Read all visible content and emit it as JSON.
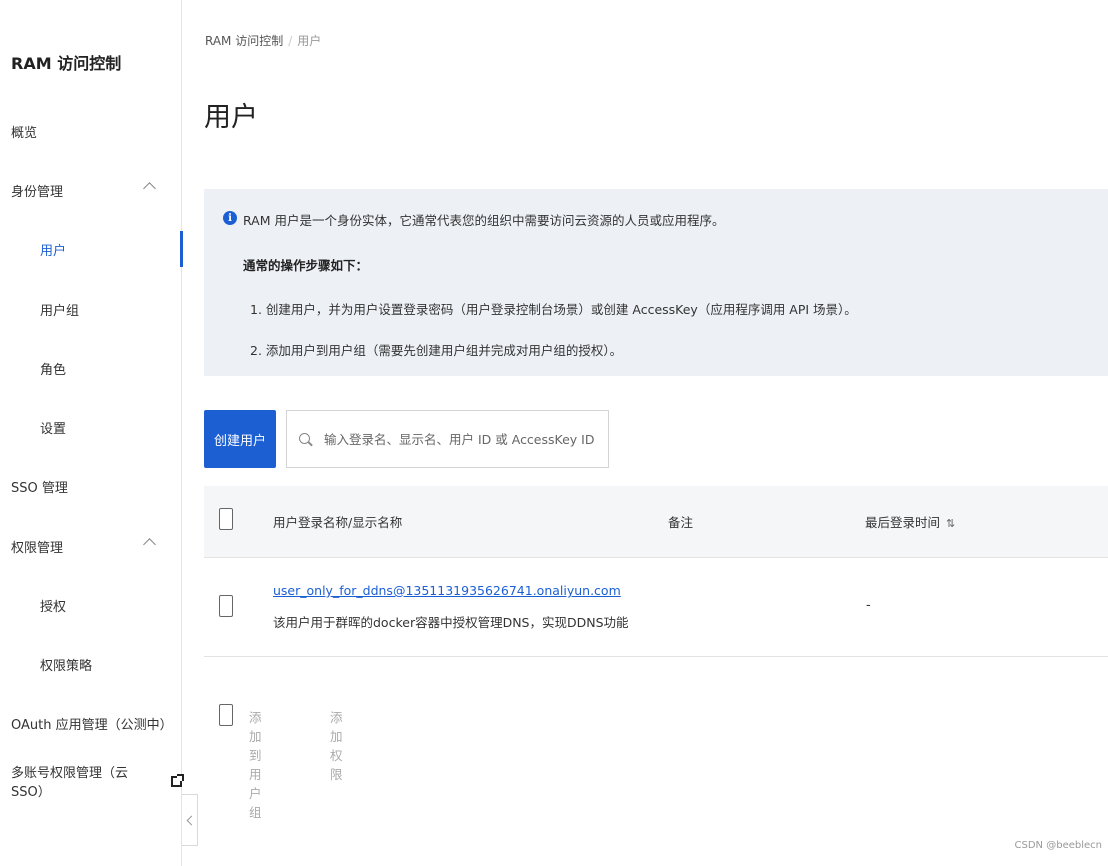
{
  "sidebar": {
    "title": "RAM 访问控制",
    "items": [
      {
        "label": "概览"
      },
      {
        "label": "身份管理"
      },
      {
        "label": "用户"
      },
      {
        "label": "用户组"
      },
      {
        "label": "角色"
      },
      {
        "label": "设置"
      },
      {
        "label": "SSO 管理"
      },
      {
        "label": "权限管理"
      },
      {
        "label": "授权"
      },
      {
        "label": "权限策略"
      },
      {
        "label": "OAuth 应用管理（公测中）"
      },
      {
        "label": "多账号权限管理（云 SSO）"
      }
    ],
    "active_item": "用户",
    "icons": {
      "expand": "chevron-up-icon",
      "external": "external-link-icon",
      "collapse": "chevron-left-icon"
    }
  },
  "breadcrumb": {
    "root": "RAM 访问控制",
    "separator": "/",
    "current": "用户"
  },
  "page_title": "用户",
  "info": {
    "line1": "RAM 用户是一个身份实体，它通常代表您的组织中需要访问云资源的人员或应用程序。",
    "heading": "通常的操作步骤如下：",
    "step1": "1. 创建用户，并为用户设置登录密码（用户登录控制台场景）或创建 AccessKey（应用程序调用 API 场景）。",
    "step2": "2. 添加用户到用户组（需要先创建用户组并完成对用户组的授权）。"
  },
  "toolbar": {
    "create_label": "创建用户",
    "search_placeholder": "输入登录名、显示名、用户 ID 或 AccessKey ID"
  },
  "table": {
    "columns": [
      "用户登录名称/显示名称",
      "备注",
      "最后登录时间"
    ],
    "sort_icon": "⇅",
    "rows": [
      {
        "login_name": "user_only_for_ddns@1351131935626741.onaliyun.com",
        "display_name": "该用户用于群晖的docker容器中授权管理DNS，实现DDNS功能",
        "note": "-"
      }
    ]
  },
  "batch_actions": {
    "add_to_group": "添加到用户组",
    "add_permission": "添加权限"
  },
  "watermark": "CSDN @beeblecn",
  "colors": {
    "accent": "#1c5fd3",
    "info_bg": "#edf1f6",
    "header_bg": "#f4f6f8"
  }
}
